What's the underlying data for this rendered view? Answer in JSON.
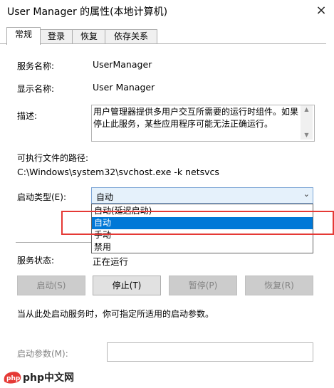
{
  "window": {
    "title": "User Manager 的属性(本地计算机)",
    "close_glyph": "×"
  },
  "tabs": [
    {
      "label": "常规"
    },
    {
      "label": "登录"
    },
    {
      "label": "恢复"
    },
    {
      "label": "依存关系"
    }
  ],
  "fields": {
    "service_name_label": "服务名称:",
    "service_name_value": "UserManager",
    "display_name_label": "显示名称:",
    "display_name_value": "User Manager",
    "description_label": "描述:",
    "description_value": "用户管理器提供多用户交互所需要的运行时组件。如果停止此服务，某些应用程序可能无法正确运行。",
    "path_label": "可执行文件的路径:",
    "path_value": "C:\\Windows\\system32\\svchost.exe -k netsvcs",
    "startup_type_label": "启动类型(E):",
    "startup_type_value": "自动"
  },
  "dropdown": {
    "options": [
      "自动(延迟启动)",
      "自动",
      "手动",
      "禁用"
    ],
    "selected_index": 1
  },
  "status": {
    "label": "服务状态:",
    "value": "正在运行"
  },
  "buttons": {
    "start": "启动(S)",
    "stop": "停止(T)",
    "pause": "暂停(P)",
    "resume": "恢复(R)"
  },
  "hint": "当从此处启动服务时，你可指定所适用的启动参数。",
  "start_params_label": "启动参数(M):",
  "watermark": {
    "text": "php中文网"
  },
  "colors": {
    "highlight": "#e53935",
    "selected": "#0078d7",
    "select_bg": "#e5f1fb"
  }
}
